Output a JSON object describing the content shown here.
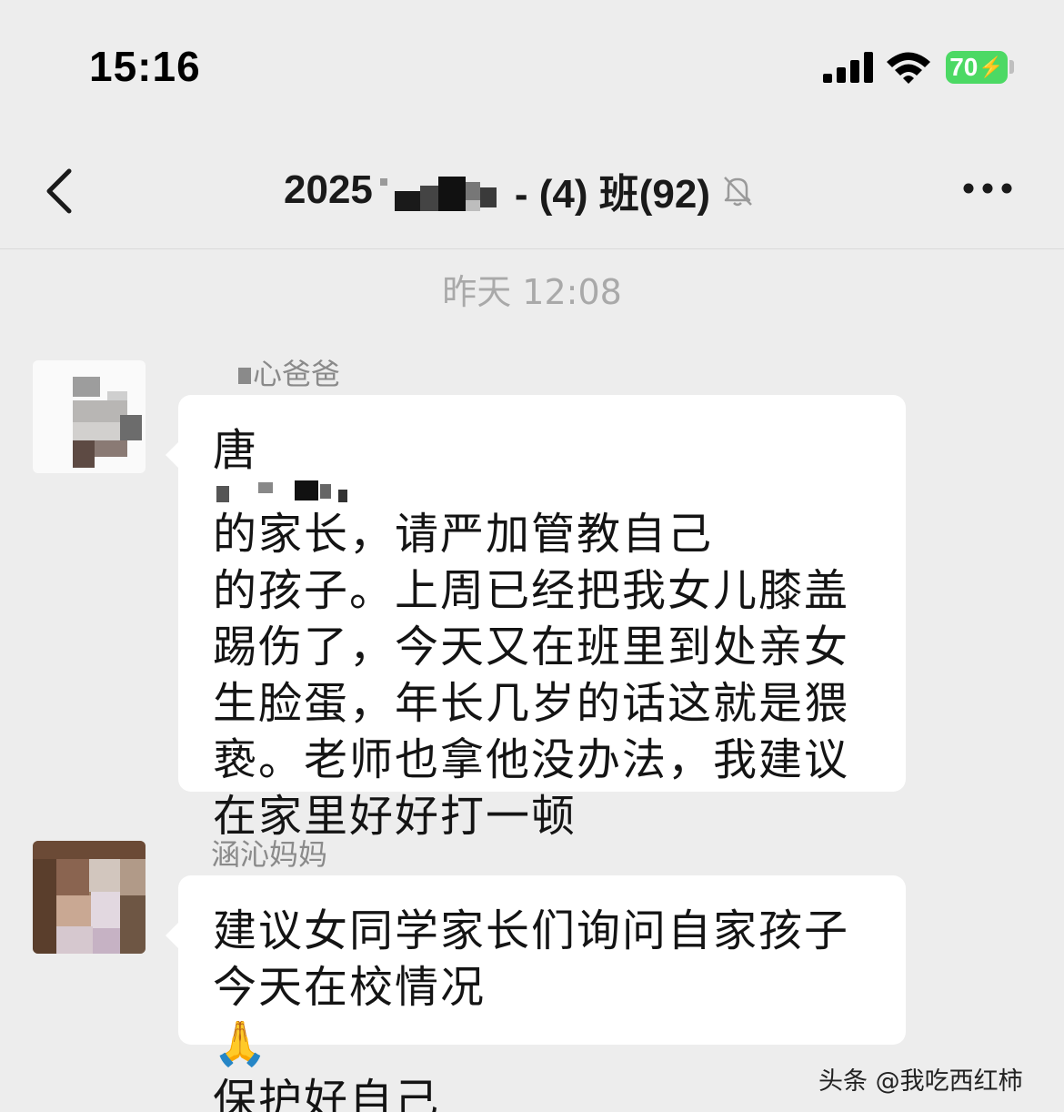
{
  "status_bar": {
    "time": "15:16",
    "battery_level": "70",
    "signal_icon": "cellular-signal-icon",
    "wifi_icon": "wifi-icon",
    "battery_color": "#4cd964"
  },
  "nav": {
    "back_icon": "chevron-left-icon",
    "title_prefix": "2025",
    "title_suffix": "- (4) 班(92)",
    "mute_icon": "bell-slash-icon",
    "more_icon": "ellipsis-icon"
  },
  "chat": {
    "timestamp": "昨天 12:08",
    "messages": [
      {
        "sender": "心爸爸",
        "text_start": "唐",
        "lines": [
          "的家长，请严加管教自己",
          "的孩子。上周已经把我女儿膝盖",
          "踢伤了，今天又在班里到处亲女",
          "生脸蛋，年长几岁的话这就是猥",
          "亵。老师也拿他没办法，我建议",
          "在家里好好打一顿"
        ]
      },
      {
        "sender": "涵沁妈妈",
        "lines": [
          "建议女同学家长们询问自家孩子",
          "今天在校情况",
          "保护好自己"
        ],
        "emoji": "🙏"
      }
    ]
  },
  "watermark": "头条 @我吃西红柿"
}
